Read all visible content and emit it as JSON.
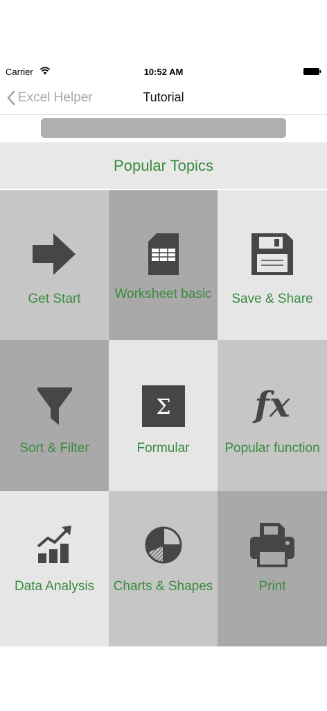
{
  "status_bar": {
    "carrier": "Carrier",
    "time": "10:52 AM"
  },
  "nav": {
    "back_label": "Excel Helper",
    "title": "Tutorial"
  },
  "section": {
    "title": "Popular Topics"
  },
  "tiles": [
    {
      "label": "Get Start",
      "icon": "arrow-right-icon"
    },
    {
      "label": "Worksheet basic",
      "icon": "sd-card-sheet-icon"
    },
    {
      "label": "Save & Share",
      "icon": "floppy-disk-icon"
    },
    {
      "label": "Sort & Filter",
      "icon": "funnel-icon"
    },
    {
      "label": "Formular",
      "icon": "sigma-icon"
    },
    {
      "label": "Popular function",
      "icon": "fx-icon"
    },
    {
      "label": "Data Analysis",
      "icon": "bar-chart-trend-icon"
    },
    {
      "label": "Charts & Shapes",
      "icon": "pie-chart-icon"
    },
    {
      "label": "Print",
      "icon": "printer-icon"
    }
  ],
  "colors": {
    "accent_green": "#3a8b3f",
    "icon_dark": "#464646",
    "tile_light": "#e6e6e6",
    "tile_mid": "#c6c6c6",
    "tile_dark": "#a9a9a9"
  }
}
